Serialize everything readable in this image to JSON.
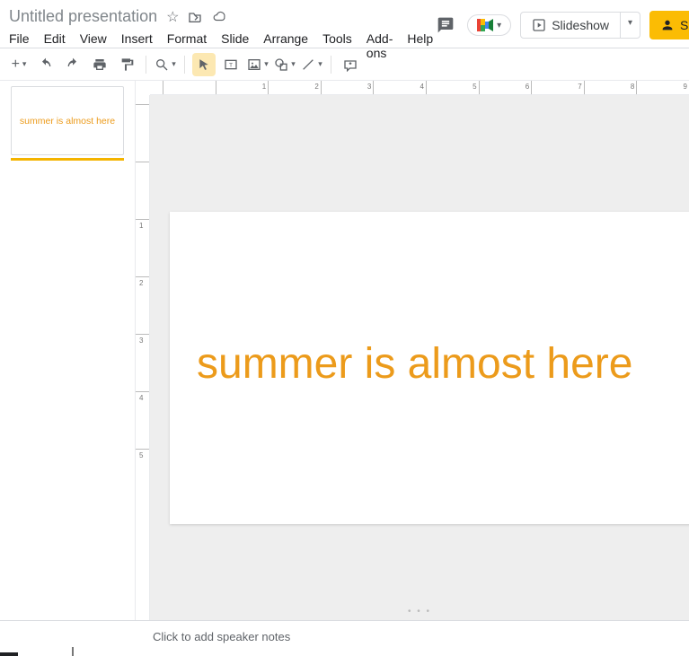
{
  "header": {
    "doc_title": "Untitled presentation",
    "menus": [
      "File",
      "Edit",
      "View",
      "Insert",
      "Format",
      "Slide",
      "Arrange",
      "Tools",
      "Add-ons",
      "Help"
    ],
    "slideshow_label": "Slideshow",
    "share_label": "Shar"
  },
  "toolbar": {
    "items": [
      {
        "name": "new-slide",
        "glyph": "+",
        "dd": true
      },
      {
        "name": "undo",
        "svg": "undo"
      },
      {
        "name": "redo",
        "svg": "redo"
      },
      {
        "name": "print",
        "svg": "print"
      },
      {
        "name": "paint-format",
        "svg": "paint"
      },
      {
        "sep": true
      },
      {
        "name": "zoom",
        "svg": "zoom",
        "dd": true
      },
      {
        "sep": true
      },
      {
        "name": "select",
        "svg": "cursor",
        "selected": true
      },
      {
        "name": "textbox",
        "svg": "textbox"
      },
      {
        "name": "image",
        "svg": "image",
        "dd": true
      },
      {
        "name": "shape",
        "svg": "shape",
        "dd": true
      },
      {
        "name": "line",
        "svg": "line",
        "dd": true
      },
      {
        "sep": true
      },
      {
        "name": "comment",
        "svg": "comment"
      }
    ]
  },
  "filmstrip": {
    "slides": [
      {
        "text": "summer is almost here",
        "selected": true
      }
    ]
  },
  "canvas": {
    "slide_text": "summer is almost here"
  },
  "ruler": {
    "h_labels": [
      "",
      "1",
      "2",
      "3",
      "4",
      "5",
      "6",
      "7",
      "8",
      "9"
    ],
    "v_labels": [
      "",
      "",
      "1",
      "2",
      "3",
      "4",
      "5"
    ]
  },
  "notes": {
    "placeholder": "Click to add speaker notes"
  }
}
